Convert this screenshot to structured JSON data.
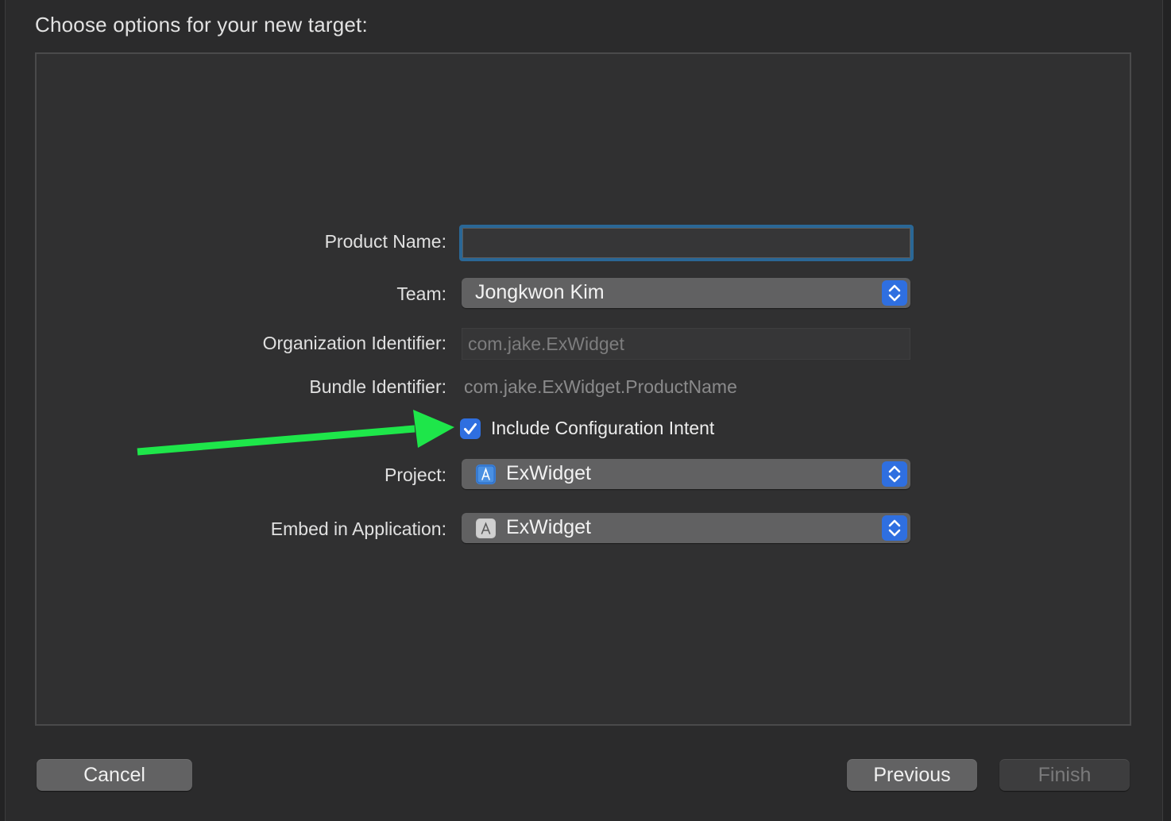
{
  "dialog": {
    "title": "Choose options for your new target:"
  },
  "form": {
    "product_name": {
      "label": "Product Name:",
      "value": ""
    },
    "team": {
      "label": "Team:",
      "value": "Jongkwon Kim"
    },
    "organization_identifier": {
      "label": "Organization Identifier:",
      "value": "com.jake.ExWidget"
    },
    "bundle_identifier": {
      "label": "Bundle Identifier:",
      "value": "com.jake.ExWidget.ProductName"
    },
    "include_configuration_intent": {
      "label": "Include Configuration Intent",
      "checked": true
    },
    "project": {
      "label": "Project:",
      "value": "ExWidget",
      "icon": "xcode-project-icon"
    },
    "embed_in_application": {
      "label": "Embed in Application:",
      "value": "ExWidget",
      "icon": "app-icon"
    }
  },
  "buttons": {
    "cancel": "Cancel",
    "previous": "Previous",
    "finish": "Finish"
  },
  "colors": {
    "accent": "#2f6fe0",
    "focus_ring": "#2a6796",
    "annotation_arrow": "#1ee64a",
    "background": "#2b2b2c"
  }
}
